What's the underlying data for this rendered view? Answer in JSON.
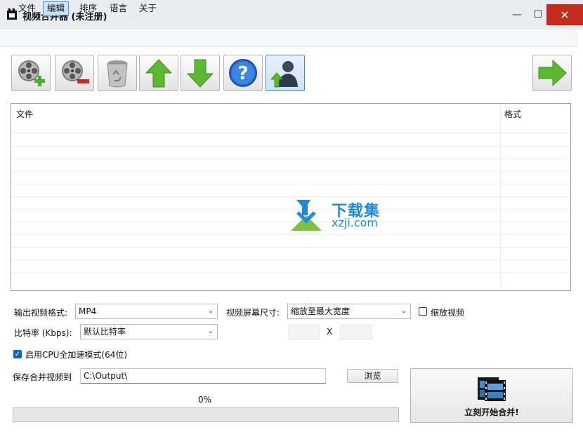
{
  "window": {
    "title": "视频合并器 (未注册)",
    "controls": {
      "minimize": "—",
      "maximize": "☐",
      "close": "✕"
    }
  },
  "menu": {
    "items": [
      {
        "label": "文件",
        "active": false
      },
      {
        "label": "编辑",
        "active": true
      },
      {
        "label": "排序",
        "active": false
      },
      {
        "label": "语言",
        "active": false
      },
      {
        "label": "关于",
        "active": false
      }
    ]
  },
  "toolbar": {
    "buttons": [
      {
        "icon": "film-reel-add-icon"
      },
      {
        "icon": "film-reel-remove-icon"
      },
      {
        "icon": "recycle-bin-icon"
      },
      {
        "icon": "arrow-up-icon"
      },
      {
        "icon": "arrow-down-icon"
      },
      {
        "icon": "help-icon"
      },
      {
        "icon": "user-upload-icon"
      },
      {
        "icon": "arrow-right-icon"
      }
    ]
  },
  "file_list": {
    "columns": [
      "文件",
      "格式"
    ],
    "rows": []
  },
  "watermark": {
    "line1": "下载集",
    "line2": "xzji.com"
  },
  "output": {
    "format_label": "输出视频格式:",
    "format_value": "MP4",
    "screen_size_label": "视频屏幕尺寸:",
    "screen_size_value": "缩放至最大宽度",
    "scale_video_label": "缩放视频",
    "scale_video_checked": false,
    "bitrate_label": "比特率 (Kbps):",
    "bitrate_value": "默认比特率",
    "size_separator": "X",
    "cpu_label": "启用CPU全加速模式(64位)",
    "cpu_checked": true,
    "save_label": "保存合并视频到",
    "save_path": "C:\\Output\\",
    "browse_label": "浏览",
    "progress_text": "0%",
    "progress_fraction": 0,
    "start_label": "立刻开始合并!"
  },
  "colors": {
    "accent": "#0a64c8",
    "close_button": "#c42b1c",
    "arrow_green": "#5cb82e",
    "watermark_blue": "#1f8bd8"
  }
}
